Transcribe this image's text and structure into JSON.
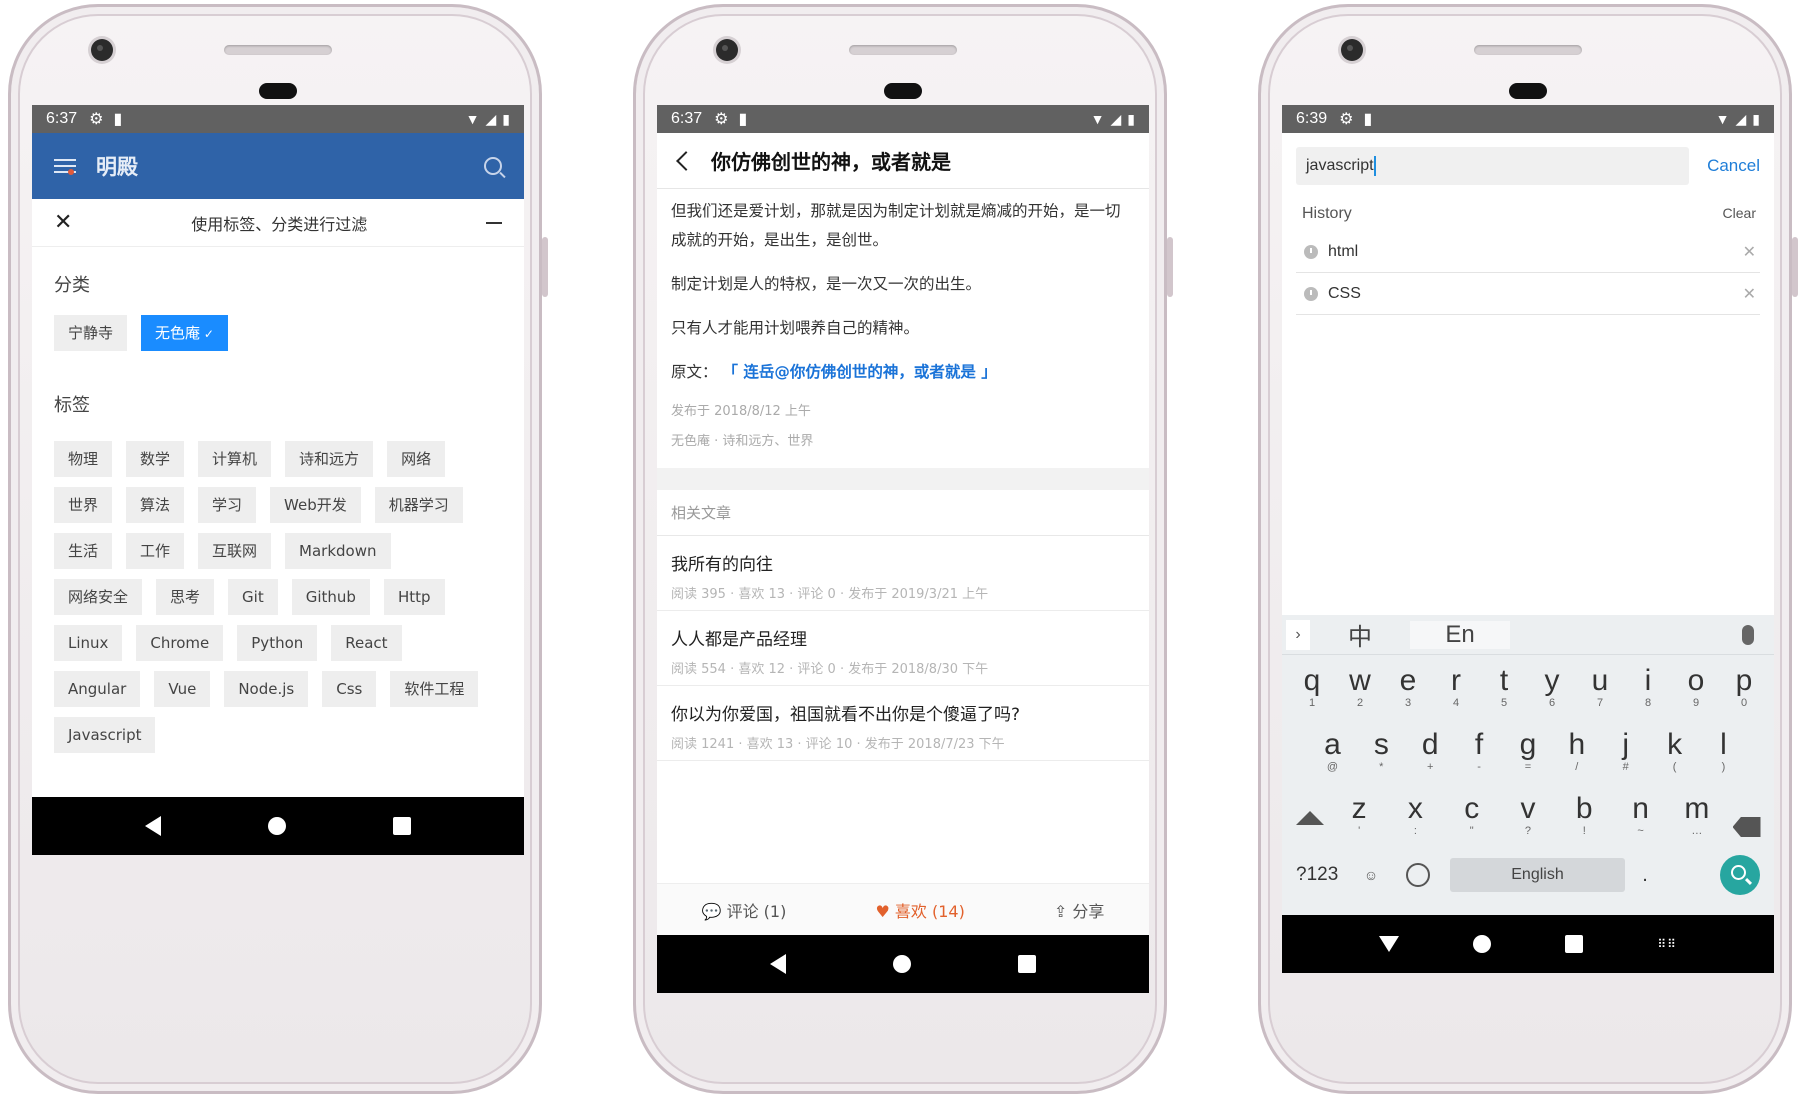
{
  "colors": {
    "accent_blue": "#2f63a8",
    "selected_chip": "#1a8cff",
    "like": "#e2612c",
    "link": "#1a73d8",
    "search_fab": "#27a6a0"
  },
  "phone1": {
    "status": {
      "time": "6:37"
    },
    "appbar": {
      "title": "明殿"
    },
    "filter": {
      "title": "使用标签、分类进行过滤"
    },
    "categories": {
      "heading": "分类",
      "items": [
        {
          "label": "宁静寺",
          "selected": false
        },
        {
          "label": "无色庵",
          "selected": true
        }
      ]
    },
    "tags": {
      "heading": "标签",
      "items": [
        "物理",
        "数学",
        "计算机",
        "诗和远方",
        "网络",
        "世界",
        "算法",
        "学习",
        "Web开发",
        "机器学习",
        "生活",
        "工作",
        "互联网",
        "Markdown",
        "网络安全",
        "思考",
        "Git",
        "Github",
        "Http",
        "Linux",
        "Chrome",
        "Python",
        "React",
        "Angular",
        "Vue",
        "Node.js",
        "Css",
        "软件工程",
        "Javascript"
      ]
    }
  },
  "phone2": {
    "status": {
      "time": "6:37"
    },
    "header": {
      "title": "你仿佛创世的神，或者就是"
    },
    "article": {
      "p1": "但我们还是爱计划，那就是因为制定计划就是熵减的开始，是一切成就的开始，是出生，是创世。",
      "p2": "制定计划是人的特权，是一次又一次的出生。",
      "p3": "只有人才能用计划喂养自己的精神。",
      "source_label": "原文：",
      "source_link": "「 连岳@你仿佛创世的神，或者就是 」",
      "published": "发布于 2018/8/12 上午",
      "category": "无色庵",
      "tags": "诗和远方、世界"
    },
    "related": {
      "heading": "相关文章",
      "items": [
        {
          "title": "我所有的向往",
          "meta": "阅读 395 · 喜欢 13 · 评论 0 · 发布于 2019/3/21 上午"
        },
        {
          "title": "人人都是产品经理",
          "meta": "阅读 554 · 喜欢 12 · 评论 0 · 发布于 2018/8/30 下午"
        },
        {
          "title": "你以为你爱国，祖国就看不出你是个傻逼了吗?",
          "meta": "阅读 1241 · 喜欢 13 · 评论 10 · 发布于 2018/7/23 下午"
        }
      ]
    },
    "footer": {
      "comment": "评论 (1)",
      "like": "喜欢 (14)",
      "share": "分享"
    }
  },
  "phone3": {
    "status": {
      "time": "6:39"
    },
    "search": {
      "value": "javascript",
      "cancel": "Cancel"
    },
    "history": {
      "heading": "History",
      "clear": "Clear",
      "items": [
        "html",
        "CSS"
      ]
    },
    "keyboard": {
      "modes": [
        "中",
        "En"
      ],
      "row1": [
        {
          "k": "q",
          "s": "1"
        },
        {
          "k": "w",
          "s": "2"
        },
        {
          "k": "e",
          "s": "3"
        },
        {
          "k": "r",
          "s": "4"
        },
        {
          "k": "t",
          "s": "5"
        },
        {
          "k": "y",
          "s": "6"
        },
        {
          "k": "u",
          "s": "7"
        },
        {
          "k": "i",
          "s": "8"
        },
        {
          "k": "o",
          "s": "9"
        },
        {
          "k": "p",
          "s": "0"
        }
      ],
      "row2": [
        {
          "k": "a",
          "s": "@"
        },
        {
          "k": "s",
          "s": "*"
        },
        {
          "k": "d",
          "s": "+"
        },
        {
          "k": "f",
          "s": "-"
        },
        {
          "k": "g",
          "s": "="
        },
        {
          "k": "h",
          "s": "/"
        },
        {
          "k": "j",
          "s": "#"
        },
        {
          "k": "k",
          "s": "("
        },
        {
          "k": "l",
          "s": ")"
        }
      ],
      "row3": [
        {
          "k": "z",
          "s": "'"
        },
        {
          "k": "x",
          "s": ":"
        },
        {
          "k": "c",
          "s": "\""
        },
        {
          "k": "v",
          "s": "?"
        },
        {
          "k": "b",
          "s": "!"
        },
        {
          "k": "n",
          "s": "~"
        },
        {
          "k": "m",
          "s": "…"
        }
      ],
      "num_key": "?123",
      "space": "English",
      "period": "."
    }
  }
}
